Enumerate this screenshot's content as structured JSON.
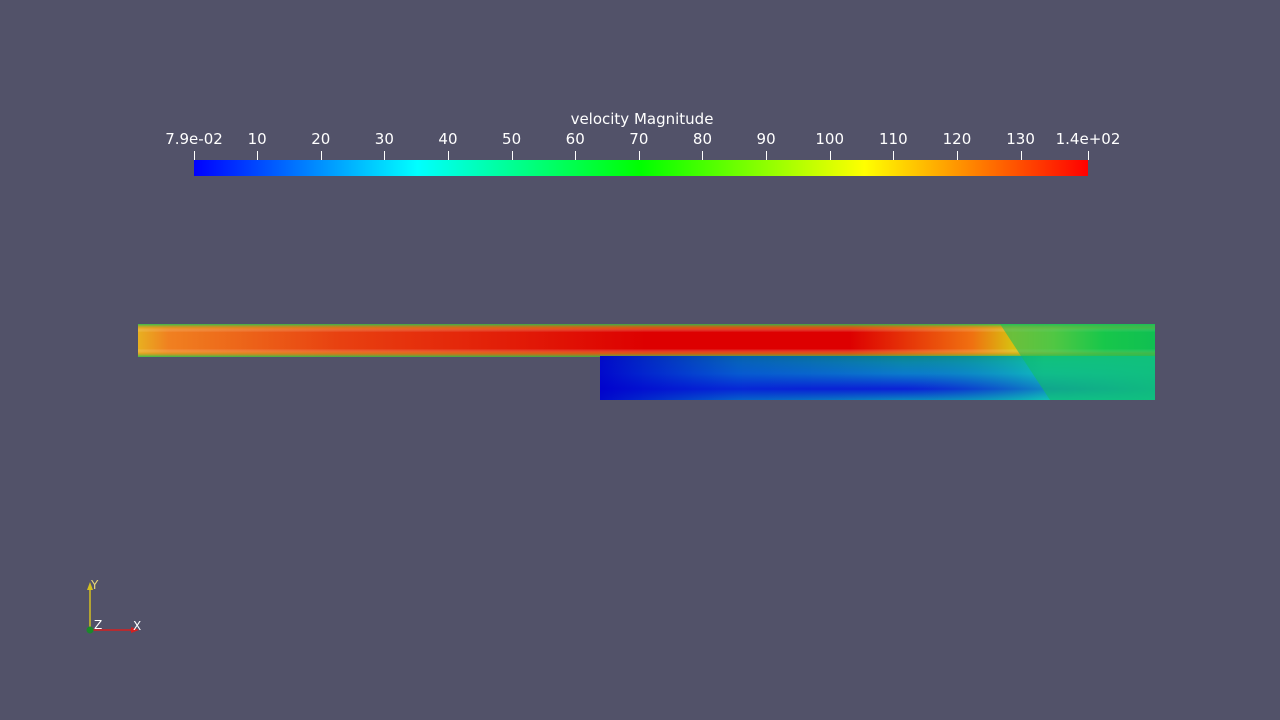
{
  "legend": {
    "title": "velocity Magnitude",
    "ticks": [
      "7.9e-02",
      "10",
      "20",
      "30",
      "40",
      "50",
      "60",
      "70",
      "80",
      "90",
      "100",
      "110",
      "120",
      "130",
      "1.4e+02"
    ],
    "tick_values": [
      0.079,
      10,
      20,
      30,
      40,
      50,
      60,
      70,
      80,
      90,
      100,
      110,
      120,
      130,
      140.6
    ],
    "range": [
      0.079,
      140.6
    ],
    "colormap": [
      "#0000ff",
      "#00ffff",
      "#00ff00",
      "#ffff00",
      "#ff0000"
    ]
  },
  "axes": {
    "x": "X",
    "y": "Y",
    "z": "Z",
    "x_color": "#d42020",
    "y_color": "#d4c020",
    "z_color": "#1a8a2a"
  },
  "background_color": "#525269"
}
